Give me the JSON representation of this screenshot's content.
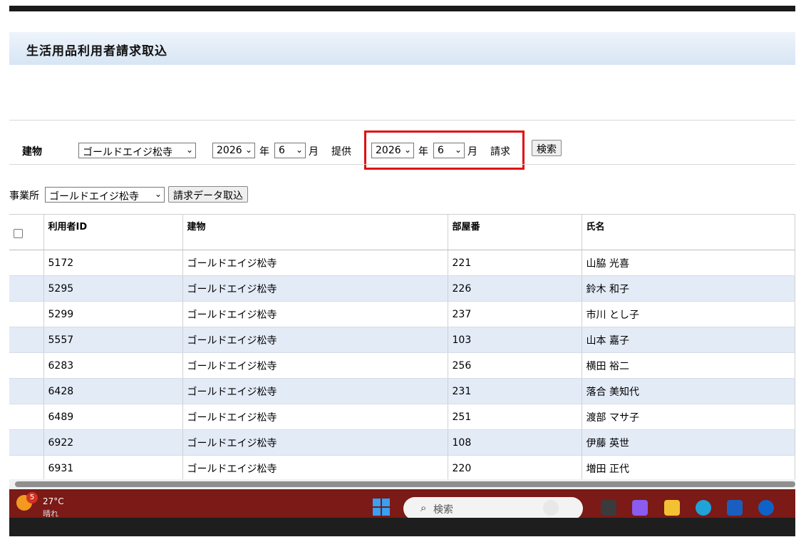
{
  "page": {
    "title": "生活用品利用者請求取込"
  },
  "filter": {
    "building_label": "建物",
    "building_value": "ゴールドエイジ松寺",
    "provide_year": "2026",
    "provide_month": "6",
    "year_label": "年",
    "month_label": "月",
    "provide_label": "提供",
    "bill_year": "2026",
    "bill_month": "6",
    "bill_label": "請求",
    "search_button": "検索"
  },
  "office": {
    "label": "事業所",
    "value": "ゴールドエイジ松寺",
    "import_button": "請求データ取込"
  },
  "table": {
    "headers": {
      "user_id": "利用者ID",
      "building": "建物",
      "room": "部屋番",
      "name": "氏名"
    },
    "rows": [
      {
        "user_id": "5172",
        "building": "ゴールドエイジ松寺",
        "room": "221",
        "name": "山脇 光喜"
      },
      {
        "user_id": "5295",
        "building": "ゴールドエイジ松寺",
        "room": "226",
        "name": "鈴木 和子"
      },
      {
        "user_id": "5299",
        "building": "ゴールドエイジ松寺",
        "room": "237",
        "name": "市川 とし子"
      },
      {
        "user_id": "5557",
        "building": "ゴールドエイジ松寺",
        "room": "103",
        "name": "山本 嘉子"
      },
      {
        "user_id": "6283",
        "building": "ゴールドエイジ松寺",
        "room": "256",
        "name": "横田 裕二"
      },
      {
        "user_id": "6428",
        "building": "ゴールドエイジ松寺",
        "room": "231",
        "name": "落合 美知代"
      },
      {
        "user_id": "6489",
        "building": "ゴールドエイジ松寺",
        "room": "251",
        "name": "渡部 マサ子"
      },
      {
        "user_id": "6922",
        "building": "ゴールドエイジ松寺",
        "room": "108",
        "name": "伊藤 英世"
      },
      {
        "user_id": "6931",
        "building": "ゴールドエイジ松寺",
        "room": "220",
        "name": "増田 正代"
      }
    ]
  },
  "taskbar": {
    "weather_badge": "5",
    "temperature": "27°C",
    "condition": "晴れ",
    "search_placeholder": "検索"
  },
  "colors": {
    "highlight_box": "#e01010",
    "taskbar": "#7b1a16",
    "row_alt": "#e3ebf7"
  }
}
